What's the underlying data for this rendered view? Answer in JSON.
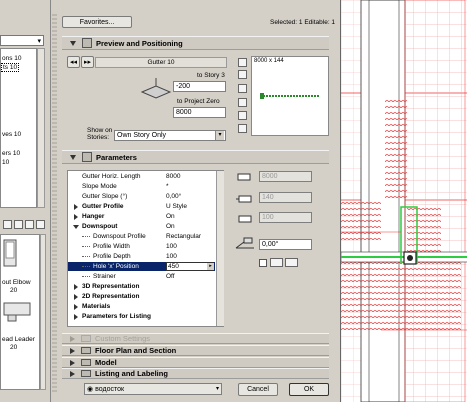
{
  "left_panel": {
    "list_items": [
      "ons 10",
      "ts 10",
      "ves 10",
      "ers 10",
      "10"
    ],
    "list_selected_index": 1,
    "items_below": [
      "out Elbow",
      "20",
      "ead Leader",
      "20"
    ]
  },
  "dialog": {
    "favorites_label": "Favorites...",
    "selected_text": "Selected: 1 Editable: 1",
    "footer": {
      "object_name": "водосток",
      "cancel_label": "Cancel",
      "ok_label": "OK"
    }
  },
  "preview": {
    "title": "Preview and Positioning",
    "object_name": "Gutter 10",
    "to_story_label": "to Story 3",
    "to_story_value": "-200",
    "to_project_zero_label": "to Project Zero",
    "to_project_zero_value": "8000",
    "show_on_stories_label": "Show on\nStories:",
    "show_on_stories_value": "Own Story Only",
    "size_label": "8000 x 144"
  },
  "parameters": {
    "title": "Parameters",
    "rows": [
      {
        "label": "Gutter Horiz. Length",
        "value": "8000",
        "bold": false,
        "level": 0,
        "toggle": "none"
      },
      {
        "label": "Slope Mode",
        "value": "*",
        "bold": false,
        "level": 0,
        "toggle": "none"
      },
      {
        "label": "Gutter Slope (°)",
        "value": "0,00°",
        "bold": false,
        "level": 0,
        "toggle": "none"
      },
      {
        "label": "Gutter Profile",
        "value": "U Style",
        "bold": true,
        "level": 0,
        "toggle": "right"
      },
      {
        "label": "Hanger",
        "value": "On",
        "bold": true,
        "level": 0,
        "toggle": "right"
      },
      {
        "label": "Downspout",
        "value": "On",
        "bold": true,
        "level": 0,
        "toggle": "down"
      },
      {
        "label": "Downspout Profile",
        "value": "Rectangular",
        "bold": false,
        "level": 1,
        "toggle": "none"
      },
      {
        "label": "Profile Width",
        "value": "100",
        "bold": false,
        "level": 1,
        "toggle": "none"
      },
      {
        "label": "Profile Depth",
        "value": "100",
        "bold": false,
        "level": 1,
        "toggle": "none"
      },
      {
        "label": "Hole 'x' Position",
        "value": "450",
        "bold": false,
        "level": 1,
        "toggle": "none",
        "selected": true
      },
      {
        "label": "Strainer",
        "value": "Off",
        "bold": false,
        "level": 1,
        "toggle": "none"
      },
      {
        "label": "3D Representation",
        "value": "",
        "bold": true,
        "level": 0,
        "toggle": "right"
      },
      {
        "label": "2D Representation",
        "value": "",
        "bold": true,
        "level": 0,
        "toggle": "right"
      },
      {
        "label": "Materials",
        "value": "",
        "bold": true,
        "level": 0,
        "toggle": "right"
      },
      {
        "label": "Parameters for Listing",
        "value": "",
        "bold": true,
        "level": 0,
        "toggle": "right"
      }
    ],
    "side_fields": {
      "length": "8000",
      "width": "140",
      "height": "100",
      "angle": "0,00°"
    }
  },
  "collapsed_panels": [
    {
      "title": "Custom Settings",
      "dim": true
    },
    {
      "title": "Floor Plan and Section",
      "dim": false
    },
    {
      "title": "Model",
      "dim": false
    },
    {
      "title": "Listing and Labeling",
      "dim": false
    }
  ],
  "colors": {
    "dialog_bg": "#d4d0c8",
    "selection": "#0a246a",
    "plan_red": "#e33333",
    "plan_green": "#2ecc40"
  }
}
